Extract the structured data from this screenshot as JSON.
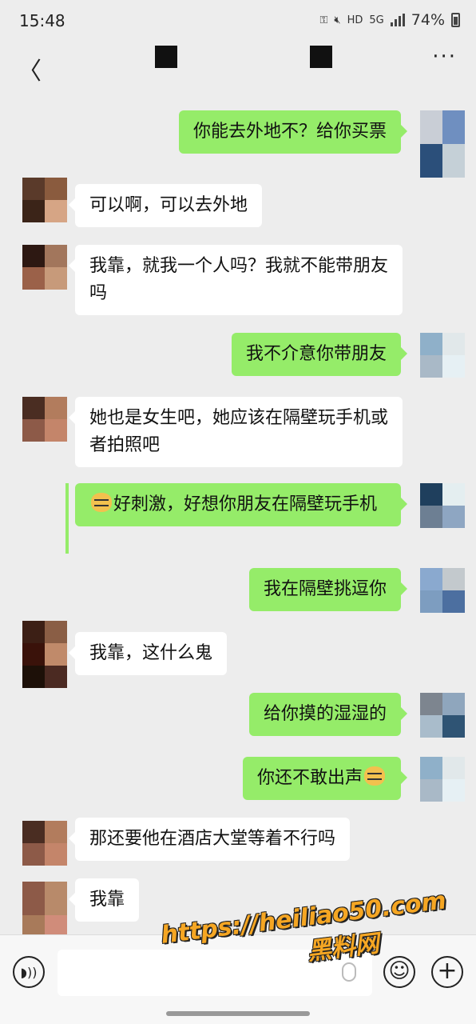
{
  "status": {
    "time": "15:48",
    "network": "5G",
    "hd": "HD",
    "battery": "74%"
  },
  "nav": {
    "back_icon": "chevron-left-icon",
    "more_icon": "more-dots-icon"
  },
  "messages": [
    {
      "side": "right",
      "text": "你能去外地不？给你买票"
    },
    {
      "side": "left",
      "text": "可以啊，可以去外地"
    },
    {
      "side": "left",
      "text": "我靠，就我一个人吗？我就不能带朋友吗"
    },
    {
      "side": "right",
      "text": "我不介意你带朋友"
    },
    {
      "side": "left",
      "text": "她也是女生吧，她应该在隔壁玩手机或者拍照吧"
    },
    {
      "side": "right",
      "text": "好刺激，好想你朋友在隔壁玩手机",
      "emoji_before": "doge-emoji"
    },
    {
      "side": "right",
      "text": "我在隔壁挑逗你"
    },
    {
      "side": "left",
      "text": "我靠，这什么鬼"
    },
    {
      "side": "right",
      "text": "给你摸的湿湿的"
    },
    {
      "side": "right",
      "text": "你还不敢出声",
      "emoji_after": "doge-emoji"
    },
    {
      "side": "left",
      "text": "那还要他在酒店大堂等着不行吗"
    },
    {
      "side": "left",
      "text": "我靠"
    }
  ],
  "watermark": {
    "url": "https://heiliao50.com",
    "name": "黑料网"
  },
  "input": {
    "value": "",
    "voice_icon": "voice-icon",
    "emoji_icon": "emoji-icon",
    "plus_icon": "plus-icon"
  },
  "colors": {
    "sent_bubble": "#95ec69",
    "received_bubble": "#ffffff",
    "background": "#ededed"
  }
}
